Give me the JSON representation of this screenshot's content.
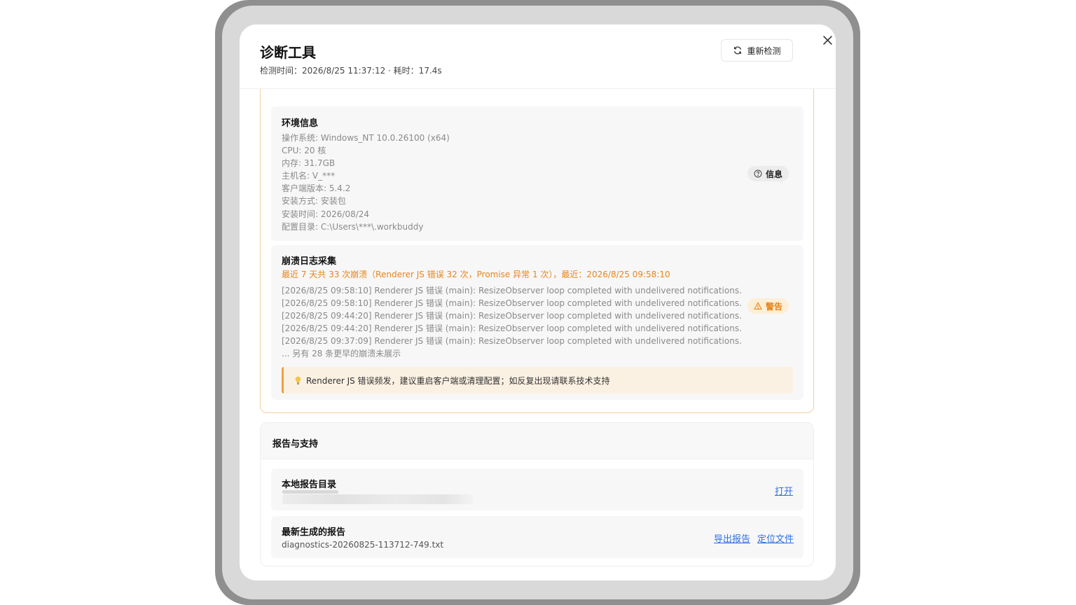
{
  "header": {
    "title": "诊断工具",
    "subtitle": "检测时间：2026/8/25 11:37:12 · 耗时：17.4s",
    "recheck_label": "重新检测"
  },
  "icons": {
    "recheck": "refresh-icon",
    "close": "close-icon",
    "info": "info-chat-icon",
    "warn": "warning-triangle-icon",
    "tip": "lightbulb-icon"
  },
  "env": {
    "title": "环境信息",
    "lines": [
      "操作系统: Windows_NT 10.0.26100 (x64)",
      "CPU: 20 核",
      "内存: 31.7GB",
      "主机名: V_***",
      "客户端版本: 5.4.2",
      "安装方式: 安装包",
      "安装时间: 2026/08/24",
      "配置目录: C:\\Users\\***\\.workbuddy"
    ],
    "badge": "信息"
  },
  "crash": {
    "title": "崩溃日志采集",
    "summary": "最近 7 天共 33 次崩溃（Renderer JS 错误 32 次，Promise 异常 1 次），最近：2026/8/25 09:58:10",
    "logs": [
      "[2026/8/25 09:58:10] Renderer JS 错误 (main): ResizeObserver loop completed with undelivered notifications.",
      "[2026/8/25 09:58:10] Renderer JS 错误 (main): ResizeObserver loop completed with undelivered notifications.",
      "[2026/8/25 09:44:20] Renderer JS 错误 (main): ResizeObserver loop completed with undelivered notifications.",
      "[2026/8/25 09:44:20] Renderer JS 错误 (main): ResizeObserver loop completed with undelivered notifications.",
      "[2026/8/25 09:37:09] Renderer JS 错误 (main): ResizeObserver loop completed with undelivered notifications.",
      "... 另有 28 条更早的崩溃未展示"
    ],
    "badge": "警告",
    "tip": "Renderer JS 错误频发，建议重启客户端或清理配置；如反复出现请联系技术支持"
  },
  "report": {
    "title": "报告与支持",
    "local_dir_title": "本地报告目录",
    "open_label": "打开",
    "latest_title": "最新生成的报告",
    "latest_file": "diagnostics-20260825-113712-749.txt",
    "export_label": "导出报告",
    "locate_label": "定位文件"
  },
  "colors": {
    "accent_warn": "#e8851a",
    "link": "#2f6fe0",
    "panel_border_warn": "#f3cfa0"
  }
}
